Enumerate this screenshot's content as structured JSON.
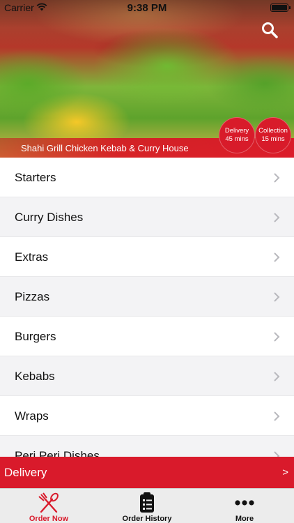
{
  "status": {
    "carrier": "Carrier",
    "time": "9:38 PM"
  },
  "restaurant": {
    "name": "Shahi Grill Chicken Kebab & Curry House"
  },
  "badges": {
    "delivery": {
      "label": "Delivery",
      "time": "45 mins"
    },
    "collection": {
      "label": "Collection",
      "time": "15 mins"
    }
  },
  "menu": {
    "items": [
      {
        "label": "Starters"
      },
      {
        "label": "Curry Dishes"
      },
      {
        "label": "Extras"
      },
      {
        "label": "Pizzas"
      },
      {
        "label": "Burgers"
      },
      {
        "label": "Kebabs"
      },
      {
        "label": "Wraps"
      },
      {
        "label": "Peri Peri Dishes"
      }
    ]
  },
  "delivery_bar": {
    "label": "Delivery",
    "arrow": ">"
  },
  "tabbar": {
    "tabs": [
      {
        "label": "Order Now",
        "icon": "fork-knife-icon"
      },
      {
        "label": "Order History",
        "icon": "clipboard-list-icon"
      },
      {
        "label": "More",
        "icon": "more-dots-icon"
      }
    ]
  },
  "colors": {
    "accent": "#d91a2b",
    "tabbar_bg": "#ececec",
    "row_alt": "#f3f3f5"
  }
}
